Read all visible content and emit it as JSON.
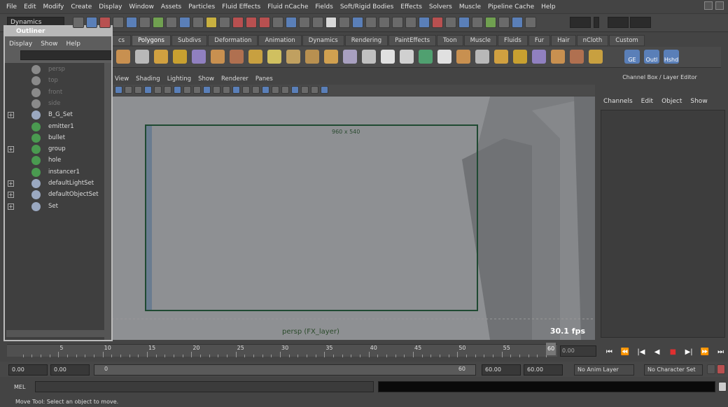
{
  "menubar": {
    "items": [
      "File",
      "Edit",
      "Modify",
      "Create",
      "Display",
      "Window",
      "Assets",
      "Particles",
      "Fluid Effects",
      "Fluid nCache",
      "Fields",
      "Soft/Rigid Bodies",
      "Effects",
      "Solvers",
      "Muscle",
      "Pipeline Cache",
      "Help"
    ]
  },
  "statusline": {
    "mode": "Dynamics"
  },
  "shelf": {
    "tabs": [
      {
        "label": "cs"
      },
      {
        "label": "Polygons"
      },
      {
        "label": "Subdivs"
      },
      {
        "label": "Deformation"
      },
      {
        "label": "Animation"
      },
      {
        "label": "Dynamics"
      },
      {
        "label": "Rendering"
      },
      {
        "label": "PaintEffects"
      },
      {
        "label": "Toon"
      },
      {
        "label": "Muscle"
      },
      {
        "label": "Fluids"
      },
      {
        "label": "Fur"
      },
      {
        "label": "Hair"
      },
      {
        "label": "nCloth"
      },
      {
        "label": "Custom"
      }
    ],
    "active_tab": "Polygons",
    "text_buttons": [
      "GE",
      "Outl",
      "Hshd"
    ]
  },
  "outliner": {
    "title": "Outliner",
    "menu": [
      "Display",
      "Show",
      "Help"
    ],
    "items": [
      {
        "label": "persp",
        "expandable": false,
        "dim": true
      },
      {
        "label": "top",
        "expandable": false,
        "dim": true
      },
      {
        "label": "front",
        "expandable": false,
        "dim": true
      },
      {
        "label": "side",
        "expandable": false,
        "dim": true
      },
      {
        "label": "B_G_Set",
        "expandable": true,
        "dim": false
      },
      {
        "label": "emitter1",
        "expandable": false,
        "dim": false
      },
      {
        "label": "bullet",
        "expandable": false,
        "dim": false
      },
      {
        "label": "group",
        "expandable": true,
        "dim": false
      },
      {
        "label": "hole",
        "expandable": false,
        "dim": false
      },
      {
        "label": "instancer1",
        "expandable": false,
        "dim": false
      },
      {
        "label": "defaultLightSet",
        "expandable": true,
        "dim": false
      },
      {
        "label": "defaultObjectSet",
        "expandable": true,
        "dim": false
      },
      {
        "label": "Set",
        "expandable": true,
        "dim": false
      }
    ]
  },
  "viewport": {
    "menu": [
      "View",
      "Shading",
      "Lighting",
      "Show",
      "Renderer",
      "Panes"
    ],
    "resolution_label": "960 x 540",
    "camera_label": "persp (FX_layer)",
    "fps": "30.1 fps"
  },
  "channelbox": {
    "title": "Channel Box / Layer Editor",
    "menu": [
      "Channels",
      "Edit",
      "Object",
      "Show"
    ]
  },
  "timeslider": {
    "ticks": [
      "5",
      "10",
      "15",
      "20",
      "25",
      "30",
      "35",
      "40",
      "45",
      "50",
      "55",
      "60"
    ],
    "end_frame": "60",
    "current_frame_field": "0.00"
  },
  "playback": {
    "buttons": [
      "⏮",
      "⏪",
      "|◀",
      "◀",
      "■",
      "▶|",
      "⏩",
      "⏭"
    ]
  },
  "rangebar": {
    "start_time": "0.00",
    "playback_start": "0.00",
    "range_start": "0",
    "range_end": "60",
    "playback_end": "60.00",
    "end_time": "60.00",
    "anim_layer": "No Anim Layer",
    "char_set": "No Character Set"
  },
  "commandline": {
    "label": "MEL"
  },
  "helpline": {
    "text": "Move Tool: Select an object to move."
  }
}
